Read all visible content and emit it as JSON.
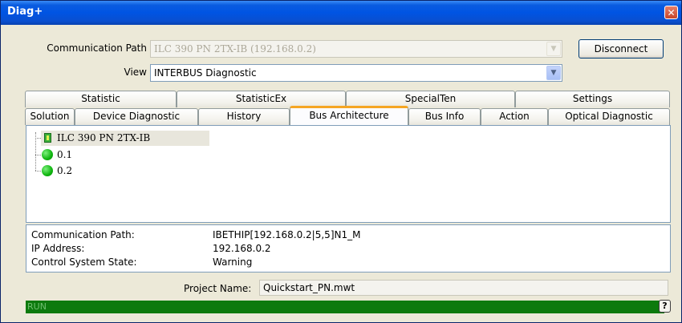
{
  "window": {
    "title": "Diag+",
    "close_glyph": "✕"
  },
  "connection": {
    "path_label": "Communication Path",
    "path_value": "ILC 390 PN 2TX-IB (192.168.0.2)",
    "view_label": "View",
    "view_value": "INTERBUS Diagnostic",
    "disconnect_label": "Disconnect"
  },
  "tabs_row1": [
    "Statistic",
    "StatisticEx",
    "SpecialTen",
    "Settings"
  ],
  "tabs_row2": [
    "Solution",
    "Device Diagnostic",
    "History",
    "Bus Architecture",
    "Bus Info",
    "Action",
    "Optical Diagnostic"
  ],
  "active_tab": "Bus Architecture",
  "tree": {
    "root": "ILC 390 PN 2TX-IB",
    "children": [
      "0.1",
      "0.2"
    ]
  },
  "info": {
    "comm_path_label": "Communication Path:",
    "comm_path_value": "IBETHIP[192.168.0.2|5,5]N1_M",
    "ip_label": "IP Address:",
    "ip_value": "192.168.0.2",
    "state_label": "Control System State:",
    "state_value": "Warning"
  },
  "project": {
    "label": "Project Name:",
    "value": "Quickstart_PN.mwt"
  },
  "status": {
    "text": "RUN",
    "help_glyph": "?"
  },
  "colors": {
    "titlebar": "#0054e3",
    "status_run": "#0d7a0d",
    "active_tab_accent": "#f5a623",
    "node_ok": "#0fb50f"
  },
  "icons": {
    "combo_arrow": "chevron-down-icon",
    "device": "device-icon",
    "node": "status-dot-icon"
  }
}
